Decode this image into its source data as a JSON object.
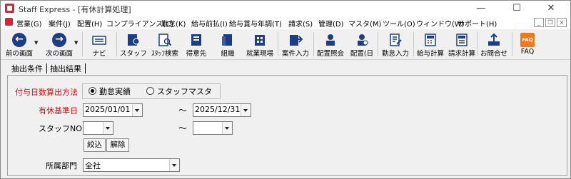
{
  "window": {
    "title": "Staff Express - [有休計算処理]",
    "minimize": "—",
    "maximize": "☐",
    "close": "✕"
  },
  "menu": {
    "items": [
      "営業(G)",
      "案件(J)",
      "配置(H)",
      "コンプライアンス(C)",
      "勤怠(K)",
      "給与前払(I)",
      "給与賞与年調(T)",
      "請求(S)",
      "管理(D)",
      "マスタ(M)",
      "ツール(O)",
      "ウィンドウ(W)",
      "サポート(H)"
    ]
  },
  "toolbar": {
    "back": "前の画面",
    "forward": "次の画面",
    "navi": "ナビ",
    "staff": "スタッフ",
    "staff_search": "ｽﾀｯﾌ検索",
    "customer": "得意先",
    "organization": "組織",
    "site": "就業現場",
    "job_entry": "案件入力",
    "placement_query": "配置照会",
    "placement_day": "配置(日",
    "attendance_entry": "勤怠入力",
    "payroll_calc": "給与計算",
    "billing_calc": "請求計算",
    "inquiry": "お問合せ",
    "faq": "FAQ",
    "faq_icon_text": "FAQ"
  },
  "tabs": [
    "抽出条件",
    "抽出結果"
  ],
  "form": {
    "method_label": "付与日数算出方法",
    "method_options": [
      "勤怠実績",
      "スタッフマスタ"
    ],
    "method_selected": "勤怠実績",
    "base_date_label": "有休基準日",
    "date_from": "2025/01/01",
    "date_to": "2025/12/31",
    "tilde": "～",
    "staff_no_label": "スタッフNO",
    "staff_no_from": "",
    "staff_no_to": "",
    "filter_button": "絞込",
    "clear_button": "解除",
    "dept_label": "所属部門",
    "dept_value": "全社"
  },
  "colors": {
    "required_label": "#e00000",
    "nav_icon": "#1b3f86",
    "faq_icon": "#f07a1a"
  }
}
